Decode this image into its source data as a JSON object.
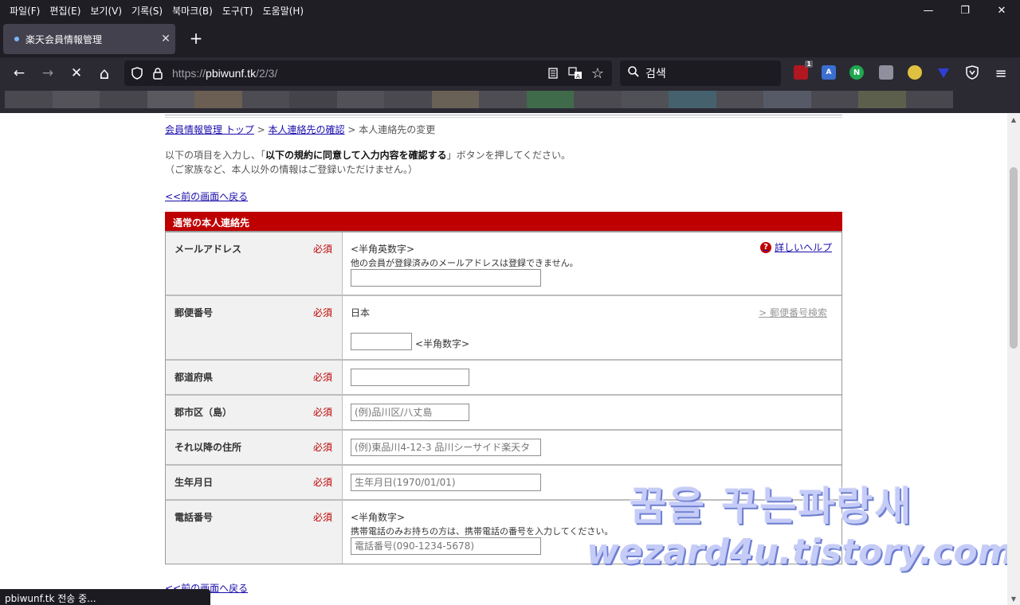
{
  "menubar": {
    "items": [
      "파일(F)",
      "편집(E)",
      "보기(V)",
      "기록(S)",
      "북마크(B)",
      "도구(T)",
      "도움말(H)"
    ]
  },
  "window_controls": {
    "minimize": "—",
    "restore": "❐",
    "close": "✕"
  },
  "tab": {
    "title": "楽天会員情報管理",
    "close": "✕",
    "new_tab": "+"
  },
  "nav": {
    "back": "←",
    "forward": "→",
    "stop": "✕",
    "home": "⌂",
    "url_prefix": "https://",
    "url_host": "pbiwunf.tk",
    "url_path": "/2/3/",
    "search_placeholder": "검색",
    "ext_badge": "1"
  },
  "breadcrumb": {
    "top_link": "会員情報管理 トップ",
    "sep1": " > ",
    "confirm_link": "本人連絡先の確認",
    "sep2": " > ",
    "current": "本人連絡先の変更"
  },
  "intro": {
    "line1_pre": "以下の項目を入力し、「",
    "line1_bold": "以下の規約に同意して入力内容を確認する",
    "line1_post": "」ボタンを押してください。",
    "line2": "（ご家族など、本人以外の情報はご登録いただけません。）"
  },
  "back_link": "<<前の画面へ戻る",
  "section_title": "通常の本人連絡先",
  "required_label": "必須",
  "fields": {
    "email": {
      "label": "メールアドレス",
      "note1": "<半角英数字>",
      "note2": "他の会員が登録済みのメールアドレスは登録できません。",
      "value": "",
      "help": "詳しいヘルプ",
      "help_icon": "?"
    },
    "zip": {
      "label": "郵便番号",
      "country": "日本",
      "search_link": "> 郵便番号検索",
      "note": "<半角数字>",
      "value": ""
    },
    "prefecture": {
      "label": "都道府県",
      "value": ""
    },
    "city": {
      "label": "郡市区（島）",
      "placeholder": "(例)品川区/八丈島"
    },
    "address": {
      "label": "それ以降の住所",
      "placeholder": "(例)東品川4-12-3 品川シーサイド楽天タ"
    },
    "birthday": {
      "label": "生年月日",
      "placeholder": "生年月日(1970/01/01)"
    },
    "phone": {
      "label": "電話番号",
      "note1": "<半角数字>",
      "note2": "携帯電話のみお持ちの方は、携帯電話の番号を入力してください。",
      "placeholder": "電話番号(090-1234-5678)"
    }
  },
  "watermark": {
    "line1": "꿈을 꾸는파랑새",
    "line2": "wezard4u.tistory.com"
  },
  "status_text": "pbiwunf.tk 전송 중..."
}
